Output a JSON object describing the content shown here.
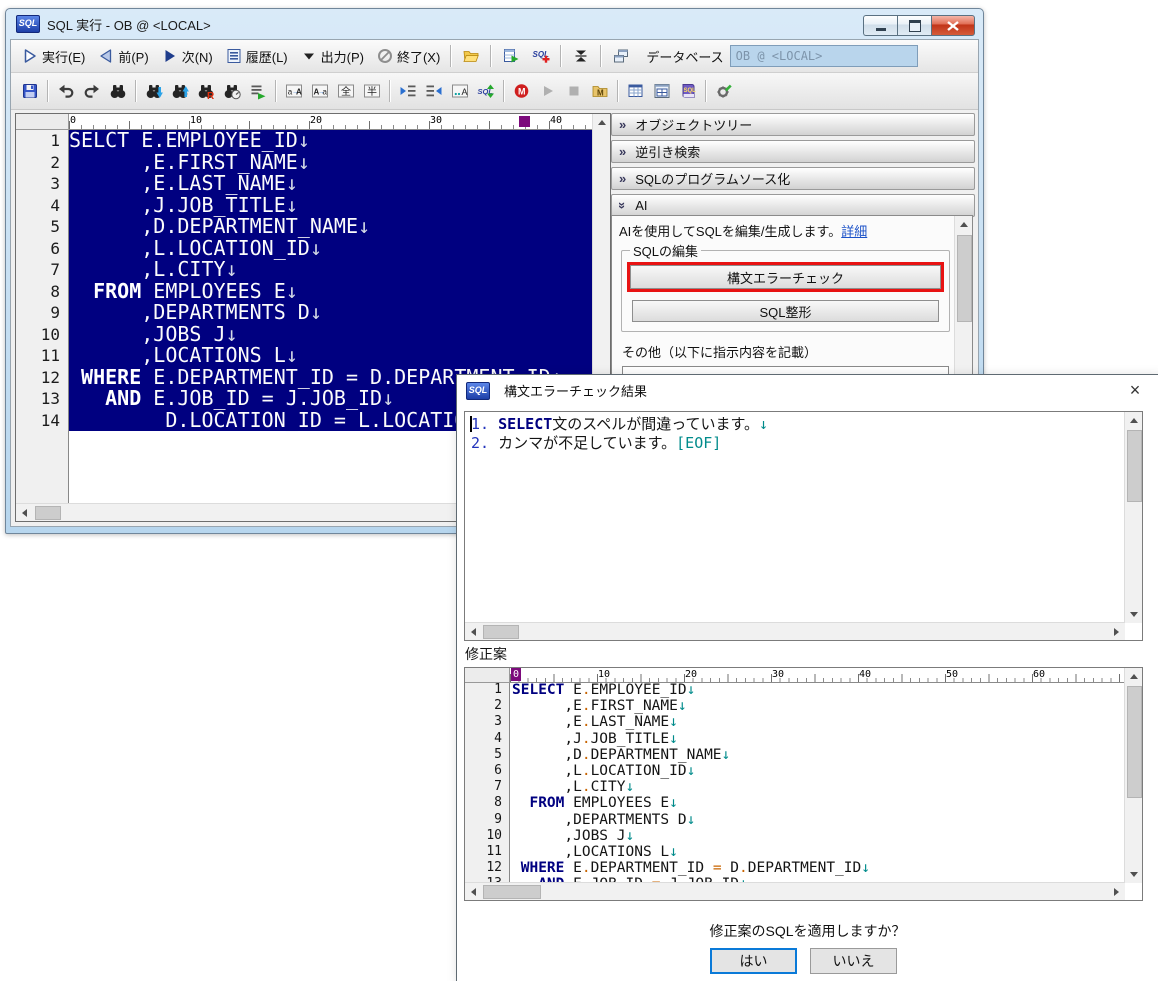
{
  "colors": {
    "selection_bg": "#000080",
    "keyword": "#000080",
    "operator": "#c86400",
    "newline_mark": "#008b8b",
    "result_number": "#2233bb",
    "link": "#1b51c8",
    "highlight_red": "#e81313",
    "aero_border": "#b7d6ee",
    "combo_bg": "#b9d5ec"
  },
  "icons": {
    "run-icon": "play-triangle-outline",
    "prev-icon": "triangle-left",
    "next-icon": "triangle-right",
    "history-icon": "list-document",
    "dropdown-icon": "triangle-down",
    "exit-icon": "no-entry-circle",
    "open-folder-icon": "open-folder",
    "table-run-icon": "table-play",
    "sql-add-icon": "sql-plus",
    "collapse-icon": "collapse-vertical",
    "window-icon": "cascade-windows",
    "save-icon": "floppy-disk",
    "undo-icon": "curved-arrow-left",
    "redo-icon": "curved-arrow-right",
    "find-icon": "binoculars",
    "find-next-icon": "binoculars-down-arrow",
    "find-prev-icon": "binoculars-up-arrow",
    "replace-icon": "binoculars-R",
    "find-all-icon": "binoculars-gauge",
    "grep-icon": "lines-green-arrow",
    "case-upper-icon": "a-to-A-box",
    "case-lower-icon": "A-to-a-box",
    "zenkaku-icon": "zenkaku-box",
    "hankaku-icon": "hankaku-box",
    "indent-icon": "indent-right",
    "outdent-icon": "indent-left",
    "space-visible-icon": "dots-A-box",
    "sql-format-icon": "sql-sync-arrows",
    "macro-record-icon": "red-M-circle",
    "macro-play-icon": "gray-play",
    "macro-stop-icon": "gray-stop",
    "macro-open-icon": "folder-M",
    "table-view-icon": "table-window",
    "result-grid-icon": "grid-window",
    "sql-reference-icon": "sql-book",
    "settings-icon": "gear-pencil"
  },
  "main_window": {
    "title": "SQL 実行 - OB @ <LOCAL>",
    "app_icon": "SQL",
    "window_controls": [
      "minimize",
      "maximize",
      "close"
    ],
    "toolbar1": {
      "items": [
        {
          "kind": "button",
          "name": "run-button",
          "icon": "run-icon",
          "label": "実行(E)"
        },
        {
          "kind": "button",
          "name": "prev-button",
          "icon": "prev-icon",
          "label": "前(P)"
        },
        {
          "kind": "button",
          "name": "next-button",
          "icon": "next-icon",
          "label": "次(N)"
        },
        {
          "kind": "button",
          "name": "history-button",
          "icon": "history-icon",
          "label": "履歴(L)"
        },
        {
          "kind": "button",
          "name": "output-button",
          "icon": "dropdown-icon",
          "label": "出力(P)"
        },
        {
          "kind": "button",
          "name": "exit-button",
          "icon": "exit-icon",
          "label": "終了(X)"
        },
        {
          "kind": "sep"
        },
        {
          "kind": "ibutton",
          "name": "open-file-button",
          "icon": "open-folder-icon"
        },
        {
          "kind": "sep"
        },
        {
          "kind": "ibutton",
          "name": "table-run-button",
          "icon": "table-run-icon"
        },
        {
          "kind": "ibutton",
          "name": "new-sql-button",
          "icon": "sql-add-icon"
        },
        {
          "kind": "sep"
        },
        {
          "kind": "ibutton",
          "name": "collapse-button",
          "icon": "collapse-icon"
        },
        {
          "kind": "sep"
        },
        {
          "kind": "ibutton",
          "name": "window-button",
          "icon": "window-icon"
        },
        {
          "kind": "label",
          "name": "database-label",
          "label": "データベース"
        },
        {
          "kind": "combo",
          "name": "database-combobox",
          "value": "OB @ <LOCAL>"
        }
      ]
    },
    "toolbar2": {
      "icons": [
        "save-icon",
        "|",
        "undo-icon",
        "redo-icon",
        "find-icon",
        "|",
        "find-next-icon",
        "find-prev-icon",
        "replace-icon",
        "find-all-icon",
        "grep-icon",
        "|",
        "case-upper-icon",
        "case-lower-icon",
        "zenkaku-icon",
        "hankaku-icon",
        "|",
        "indent-icon",
        "outdent-icon",
        "space-visible-icon",
        "sql-format-icon",
        "|",
        "macro-record-icon",
        "macro-play-icon",
        "macro-stop-icon",
        "macro-open-icon",
        "|",
        "table-view-icon",
        "result-grid-icon",
        "sql-reference-icon",
        "|",
        "settings-icon"
      ]
    },
    "editor": {
      "ruler_labels": [
        "0",
        "10",
        "20",
        "30",
        "40"
      ],
      "ruler_marker_col": 37.5,
      "lines": [
        [
          [
            "pl",
            "SELCT E.EMPLOYEE_ID"
          ],
          [
            "nl",
            "↓"
          ]
        ],
        [
          [
            "pl",
            "      ,E.FIRST_NAME"
          ],
          [
            "nl",
            "↓"
          ]
        ],
        [
          [
            "pl",
            "      ,E.LAST_NAME"
          ],
          [
            "nl",
            "↓"
          ]
        ],
        [
          [
            "pl",
            "      ,J.JOB_TITLE"
          ],
          [
            "nl",
            "↓"
          ]
        ],
        [
          [
            "pl",
            "      ,D.DEPARTMENT_NAME"
          ],
          [
            "nl",
            "↓"
          ]
        ],
        [
          [
            "pl",
            "      ,L.LOCATION_ID"
          ],
          [
            "nl",
            "↓"
          ]
        ],
        [
          [
            "pl",
            "      ,L.CITY"
          ],
          [
            "nl",
            "↓"
          ]
        ],
        [
          [
            "pl",
            "  "
          ],
          [
            "kw",
            "FROM"
          ],
          [
            "pl",
            " EMPLOYEES E"
          ],
          [
            "nl",
            "↓"
          ]
        ],
        [
          [
            "pl",
            "      ,DEPARTMENTS D"
          ],
          [
            "nl",
            "↓"
          ]
        ],
        [
          [
            "pl",
            "      ,JOBS J"
          ],
          [
            "nl",
            "↓"
          ]
        ],
        [
          [
            "pl",
            "      ,LOCATIONS L"
          ],
          [
            "nl",
            "↓"
          ]
        ],
        [
          [
            "pl",
            " "
          ],
          [
            "kw",
            "WHERE"
          ],
          [
            "pl",
            " E.DEPARTMENT_ID = D.DEPARTMENT_ID"
          ],
          [
            "nl",
            "↓"
          ]
        ],
        [
          [
            "pl",
            "   "
          ],
          [
            "kw",
            "AND"
          ],
          [
            "pl",
            " E.JOB_ID = J.JOB_ID"
          ],
          [
            "nl",
            "↓"
          ]
        ],
        [
          [
            "pl",
            "        D.LOCATION_ID = L.LOCATION_ID"
          ],
          [
            "nl",
            "↓"
          ]
        ]
      ]
    },
    "right_panel": {
      "chevron_collapsed": "»",
      "chevron_expanded": "»",
      "sections": [
        {
          "name": "object-tree",
          "label": "オブジェクトツリー",
          "expanded": false
        },
        {
          "name": "reverse-search",
          "label": "逆引き検索",
          "expanded": false
        },
        {
          "name": "sql-to-source",
          "label": "SQLのプログラムソース化",
          "expanded": false
        },
        {
          "name": "ai",
          "label": "AI",
          "expanded": true
        }
      ],
      "ai": {
        "intro": "AIを使用してSQLを編集/生成します。",
        "detail_link": "詳細",
        "group_label": "SQLの編集",
        "syntax_check_button": "構文エラーチェック",
        "format_button": "SQL整形",
        "other_label": "その他（以下に指示内容を記載）"
      }
    }
  },
  "dialog": {
    "title": "構文エラーチェック結果",
    "app_icon": "SQL",
    "close_glyph": "×",
    "results_lines": [
      [
        [
          "num",
          "1."
        ],
        [
          "t",
          " "
        ],
        [
          "kw",
          "SELECT"
        ],
        [
          "t",
          "文のスペルが間違っています。"
        ],
        [
          "nl",
          "↓"
        ]
      ],
      [
        [
          "num",
          "2."
        ],
        [
          "t",
          " カンマが不足しています。"
        ],
        [
          "eof",
          "[EOF]"
        ]
      ]
    ],
    "proposal_label": "修正案",
    "proposal_ruler_labels": [
      "0",
      "10",
      "20",
      "30",
      "40",
      "50",
      "60"
    ],
    "proposal_lines": [
      [
        [
          "kw",
          "SELECT"
        ],
        [
          "pl",
          " E"
        ],
        [
          "op",
          "."
        ],
        [
          "pl",
          "EMPLOYEE_ID"
        ],
        [
          "nl",
          "↓"
        ]
      ],
      [
        [
          "pl",
          "      ,E"
        ],
        [
          "op",
          "."
        ],
        [
          "pl",
          "FIRST_NAME"
        ],
        [
          "nl",
          "↓"
        ]
      ],
      [
        [
          "pl",
          "      ,E"
        ],
        [
          "op",
          "."
        ],
        [
          "pl",
          "LAST_NAME"
        ],
        [
          "nl",
          "↓"
        ]
      ],
      [
        [
          "pl",
          "      ,J"
        ],
        [
          "op",
          "."
        ],
        [
          "pl",
          "JOB_TITLE"
        ],
        [
          "nl",
          "↓"
        ]
      ],
      [
        [
          "pl",
          "      ,D"
        ],
        [
          "op",
          "."
        ],
        [
          "pl",
          "DEPARTMENT_NAME"
        ],
        [
          "nl",
          "↓"
        ]
      ],
      [
        [
          "pl",
          "      ,L"
        ],
        [
          "op",
          "."
        ],
        [
          "pl",
          "LOCATION_ID"
        ],
        [
          "nl",
          "↓"
        ]
      ],
      [
        [
          "pl",
          "      ,L"
        ],
        [
          "op",
          "."
        ],
        [
          "pl",
          "CITY"
        ],
        [
          "nl",
          "↓"
        ]
      ],
      [
        [
          "pl",
          "  "
        ],
        [
          "kw",
          "FROM"
        ],
        [
          "pl",
          " EMPLOYEES E"
        ],
        [
          "nl",
          "↓"
        ]
      ],
      [
        [
          "pl",
          "      ,DEPARTMENTS D"
        ],
        [
          "nl",
          "↓"
        ]
      ],
      [
        [
          "pl",
          "      ,JOBS J"
        ],
        [
          "nl",
          "↓"
        ]
      ],
      [
        [
          "pl",
          "      ,LOCATIONS L"
        ],
        [
          "nl",
          "↓"
        ]
      ],
      [
        [
          "pl",
          " "
        ],
        [
          "kw",
          "WHERE"
        ],
        [
          "pl",
          " E"
        ],
        [
          "op",
          "."
        ],
        [
          "pl",
          "DEPARTMENT_ID "
        ],
        [
          "op",
          "="
        ],
        [
          "pl",
          " D"
        ],
        [
          "op",
          "."
        ],
        [
          "pl",
          "DEPARTMENT_ID"
        ],
        [
          "nl",
          "↓"
        ]
      ],
      [
        [
          "pl",
          "   "
        ],
        [
          "kw",
          "AND"
        ],
        [
          "pl",
          " E"
        ],
        [
          "op",
          "."
        ],
        [
          "pl",
          "JOB_ID "
        ],
        [
          "op",
          "="
        ],
        [
          "pl",
          " J"
        ],
        [
          "op",
          "."
        ],
        [
          "pl",
          "JOB_ID"
        ],
        [
          "nl",
          "↓"
        ]
      ]
    ],
    "question": "修正案のSQLを適用しますか？",
    "yes_button": "はい",
    "no_button": "いいえ"
  }
}
